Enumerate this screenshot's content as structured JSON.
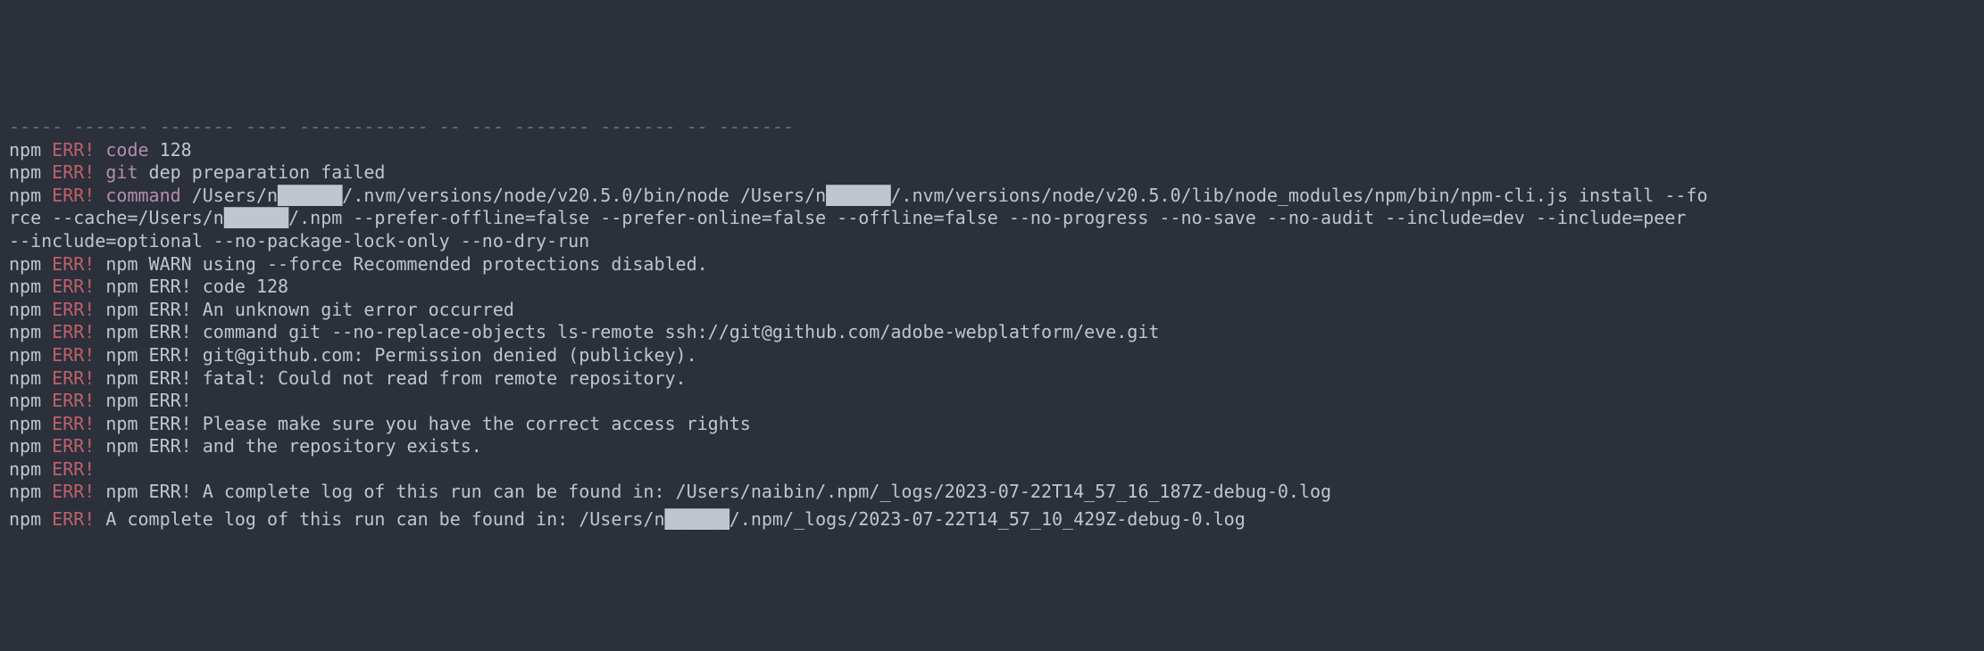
{
  "lines": [
    {
      "parts": [
        {
          "cls": "faded",
          "text": "----- ------- ------- ---- ------------ -- --- ------- ------- -- -------"
        }
      ]
    },
    {
      "parts": [
        {
          "cls": "npm",
          "text": "npm "
        },
        {
          "cls": "err",
          "text": "ERR!"
        },
        {
          "cls": "txt",
          "text": " "
        },
        {
          "cls": "cmd",
          "text": "code"
        },
        {
          "cls": "txt",
          "text": " 128"
        }
      ]
    },
    {
      "parts": [
        {
          "cls": "npm",
          "text": "npm "
        },
        {
          "cls": "err",
          "text": "ERR!"
        },
        {
          "cls": "txt",
          "text": " "
        },
        {
          "cls": "cmd",
          "text": "git"
        },
        {
          "cls": "txt",
          "text": " dep preparation failed"
        }
      ]
    },
    {
      "parts": [
        {
          "cls": "npm",
          "text": "npm "
        },
        {
          "cls": "err",
          "text": "ERR!"
        },
        {
          "cls": "txt",
          "text": " "
        },
        {
          "cls": "cmd",
          "text": "command"
        },
        {
          "cls": "txt",
          "text": " /Users/n██████/.nvm/versions/node/v20.5.0/bin/node /Users/n██████/.nvm/versions/node/v20.5.0/lib/node_modules/npm/bin/npm-cli.js install --fo"
        }
      ]
    },
    {
      "parts": [
        {
          "cls": "txt",
          "text": "rce --cache=/Users/n██████/.npm --prefer-offline=false --prefer-online=false --offline=false --no-progress --no-save --no-audit --include=dev --include=peer "
        }
      ]
    },
    {
      "parts": [
        {
          "cls": "txt",
          "text": "--include=optional --no-package-lock-only --no-dry-run"
        }
      ]
    },
    {
      "parts": [
        {
          "cls": "npm",
          "text": "npm "
        },
        {
          "cls": "err",
          "text": "ERR!"
        },
        {
          "cls": "txt",
          "text": " npm WARN using --force Recommended protections disabled."
        }
      ]
    },
    {
      "parts": [
        {
          "cls": "npm",
          "text": "npm "
        },
        {
          "cls": "err",
          "text": "ERR!"
        },
        {
          "cls": "txt",
          "text": " npm ERR! code 128"
        }
      ]
    },
    {
      "parts": [
        {
          "cls": "npm",
          "text": "npm "
        },
        {
          "cls": "err",
          "text": "ERR!"
        },
        {
          "cls": "txt",
          "text": " npm ERR! An unknown git error occurred"
        }
      ]
    },
    {
      "parts": [
        {
          "cls": "npm",
          "text": "npm "
        },
        {
          "cls": "err",
          "text": "ERR!"
        },
        {
          "cls": "txt",
          "text": " npm ERR! command git --no-replace-objects ls-remote ssh://git@github.com/adobe-webplatform/eve.git"
        }
      ]
    },
    {
      "parts": [
        {
          "cls": "npm",
          "text": "npm "
        },
        {
          "cls": "err",
          "text": "ERR!"
        },
        {
          "cls": "txt",
          "text": " npm ERR! git@github.com: Permission denied (publickey)."
        }
      ]
    },
    {
      "parts": [
        {
          "cls": "npm",
          "text": "npm "
        },
        {
          "cls": "err",
          "text": "ERR!"
        },
        {
          "cls": "txt",
          "text": " npm ERR! fatal: Could not read from remote repository."
        }
      ]
    },
    {
      "parts": [
        {
          "cls": "npm",
          "text": "npm "
        },
        {
          "cls": "err",
          "text": "ERR!"
        },
        {
          "cls": "txt",
          "text": " npm ERR!"
        }
      ]
    },
    {
      "parts": [
        {
          "cls": "npm",
          "text": "npm "
        },
        {
          "cls": "err",
          "text": "ERR!"
        },
        {
          "cls": "txt",
          "text": " npm ERR! Please make sure you have the correct access rights"
        }
      ]
    },
    {
      "parts": [
        {
          "cls": "npm",
          "text": "npm "
        },
        {
          "cls": "err",
          "text": "ERR!"
        },
        {
          "cls": "txt",
          "text": " npm ERR! and the repository exists."
        }
      ]
    },
    {
      "parts": [
        {
          "cls": "npm",
          "text": "npm "
        },
        {
          "cls": "err",
          "text": "ERR!"
        }
      ]
    },
    {
      "parts": [
        {
          "cls": "npm",
          "text": "npm "
        },
        {
          "cls": "err",
          "text": "ERR!"
        },
        {
          "cls": "txt",
          "text": " npm ERR! A complete log of this run can be found in: /Users/naibin/.npm/_logs/2023-07-22T14_57_16_187Z-debug-0.log"
        }
      ]
    },
    {
      "gap": true
    },
    {
      "parts": [
        {
          "cls": "npm",
          "text": "npm "
        },
        {
          "cls": "err",
          "text": "ERR!"
        },
        {
          "cls": "txt",
          "text": " A complete log of this run can be found in: /Users/n██████/.npm/_logs/2023-07-22T14_57_10_429Z-debug-0.log"
        }
      ]
    }
  ]
}
